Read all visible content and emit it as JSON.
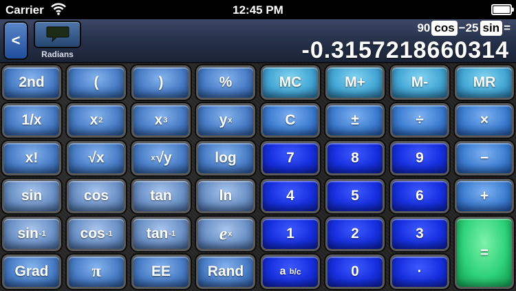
{
  "statusbar": {
    "carrier": "Carrier",
    "time": "12:45 PM"
  },
  "display": {
    "back_label": "<",
    "mode_label": "Radians",
    "expression": {
      "num1": "90",
      "fn1": "cos",
      "num2": "−25",
      "fn2": "sin",
      "equals": "="
    },
    "result": "-0.3157218660314"
  },
  "keys": {
    "k2nd": "2nd",
    "lparen": "(",
    "rparen": ")",
    "percent": "%",
    "mc": "MC",
    "mplus": "M+",
    "mminus": "M-",
    "mr": "MR",
    "recip": "1/x",
    "x2_base": "x",
    "x2_exp": "2",
    "x3_base": "x",
    "x3_exp": "3",
    "yx_base": "y",
    "yx_exp": "x",
    "clear": "C",
    "plusminus": "±",
    "divide": "÷",
    "multiply": "×",
    "fact": "x!",
    "sqrt": "√x",
    "xroot_idx": "x",
    "xroot": "√y",
    "log": "log",
    "n7": "7",
    "n8": "8",
    "n9": "9",
    "minus": "−",
    "sin": "sin",
    "cos": "cos",
    "tan": "tan",
    "ln": "ln",
    "n4": "4",
    "n5": "5",
    "n6": "6",
    "plus": "+",
    "asin": "sin",
    "acos": "cos",
    "atan": "tan",
    "inv_exp": "-1",
    "ex_base": "e",
    "ex_exp": "x",
    "n1": "1",
    "n2": "2",
    "n3": "3",
    "equals": "=",
    "grad": "Grad",
    "pi": "π",
    "ee": "EE",
    "rand": "Rand",
    "frac_a": "a",
    "frac_b": "b",
    "frac_c": "/c",
    "n0": "0",
    "dot": "·"
  },
  "colors": {
    "number_key": "#1630e0",
    "equals_key": "#2fd37a",
    "memory_key": "#46a8d6"
  }
}
